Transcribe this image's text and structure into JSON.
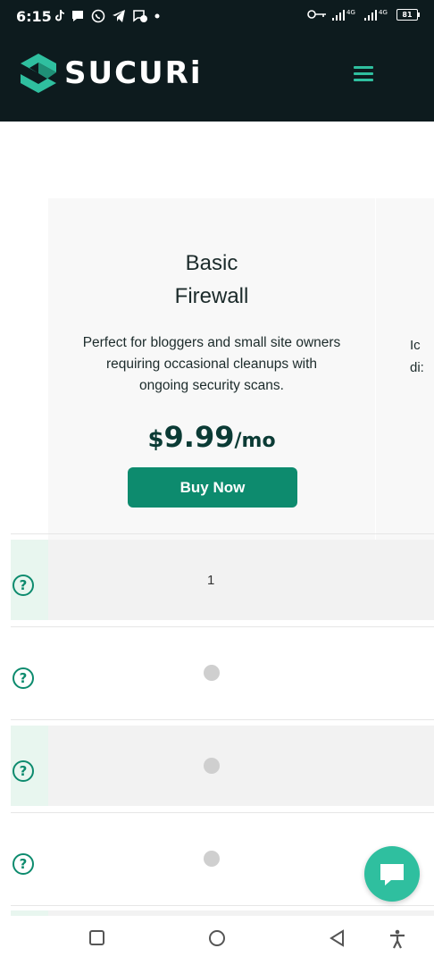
{
  "status_bar": {
    "time": "6:15",
    "battery": "81",
    "network_label_1": "4G",
    "network_label_2": "4G"
  },
  "header": {
    "brand": "SUCURi",
    "menu_icon": "hamburger-menu-icon",
    "accent_color": "#2fbf9f",
    "background_color": "#0d1b1e"
  },
  "plan": {
    "title_line1": "Basic",
    "title_line2": "Firewall",
    "description_line1": "Perfect for bloggers and small site owners",
    "description_line2": "requiring occasional cleanups with",
    "description_line3": "ongoing security scans.",
    "price_currency": "$",
    "price_amount": "9.99",
    "price_period": "/mo",
    "buy_label": "Buy Now",
    "button_color": "#0d8b6e"
  },
  "next_plan_fragment": {
    "line1": "Ic",
    "line2": "di:"
  },
  "feature_rows": [
    {
      "help_icon": "question-circle-icon",
      "value": "1"
    },
    {
      "help_icon": "question-circle-icon",
      "value": "not-included-dot"
    },
    {
      "help_icon": "question-circle-icon",
      "value": "not-included-dot"
    },
    {
      "help_icon": "question-circle-icon",
      "value": "not-included-dot"
    }
  ],
  "help_glyph": "?",
  "chat_widget": {
    "icon": "chat-bubble-icon"
  },
  "bottom_nav": {
    "recent_icon": "square-recent-apps-icon",
    "home_icon": "circle-home-icon",
    "back_icon": "triangle-back-icon",
    "accessibility_icon": "accessibility-icon"
  }
}
